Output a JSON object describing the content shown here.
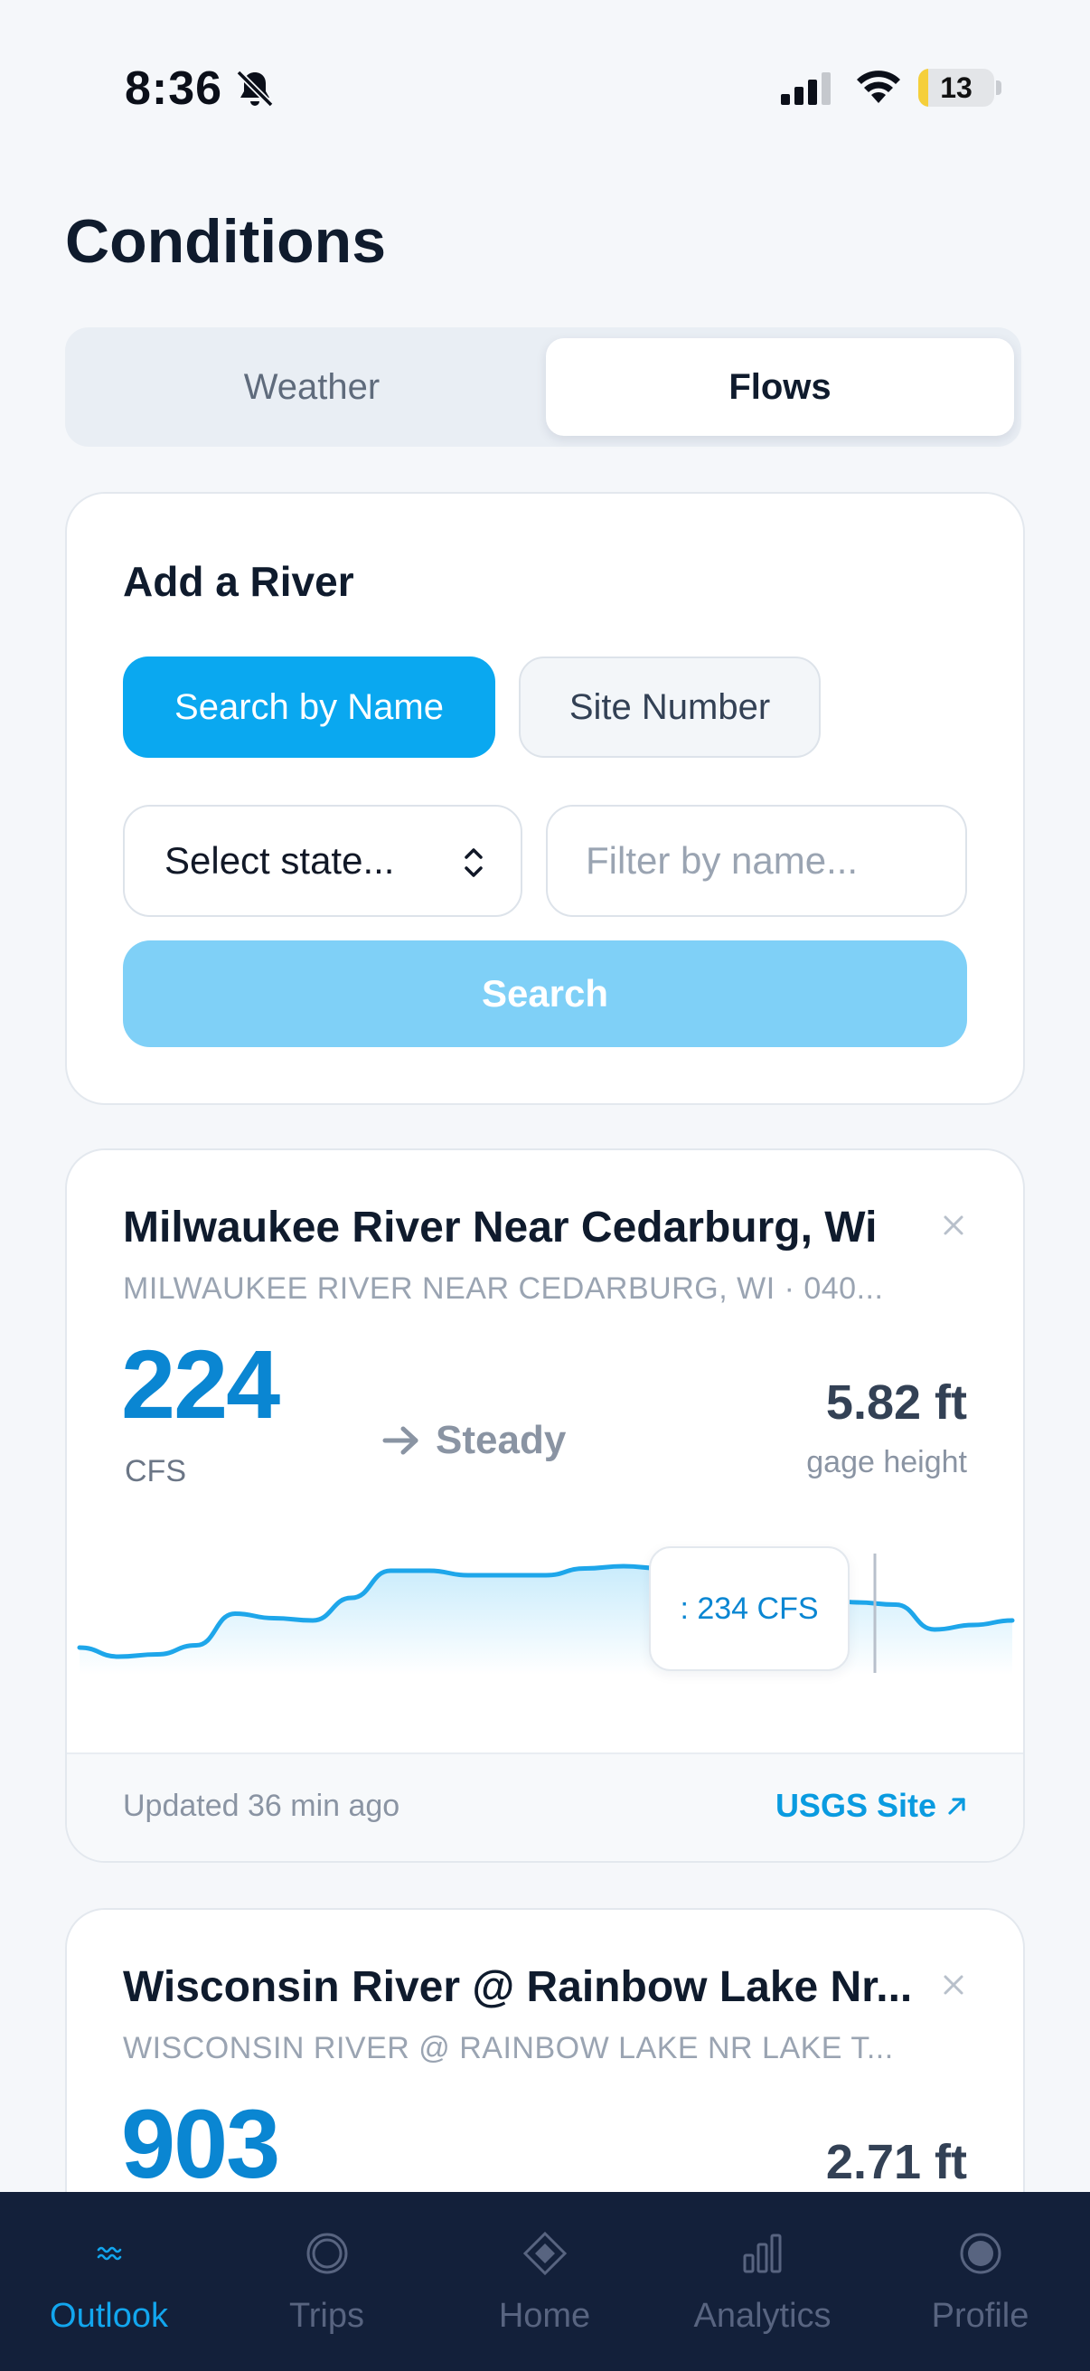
{
  "status_bar": {
    "time": "8:36",
    "battery": "13",
    "battery_level": 0.13
  },
  "page": {
    "title": "Conditions"
  },
  "tabs": {
    "weather": "Weather",
    "flows": "Flows",
    "selected": "Flows"
  },
  "add_river": {
    "title": "Add a River",
    "modes": {
      "by_name": "Search by Name",
      "site_number": "Site Number",
      "selected": "Search by Name"
    },
    "state_select": "Select state...",
    "name_filter_placeholder": "Filter by name...",
    "search_label": "Search"
  },
  "rivers": [
    {
      "name": "Milwaukee River Near Cedarburg, Wi",
      "subtitle": "MILWAUKEE RIVER NEAR CEDARBURG, WI · 040...",
      "flow": "224",
      "unit": "CFS",
      "trend": "Steady",
      "gage_height": "5.82 ft",
      "gage_label": "gage height",
      "tooltip": ": 234 CFS",
      "updated": "Updated 36 min ago",
      "link": "USGS Site",
      "series": [
        200,
        196,
        197,
        201,
        215,
        213,
        212,
        222,
        234,
        234,
        232,
        232,
        232,
        235,
        236,
        235,
        232,
        228,
        225,
        222,
        220,
        219,
        208,
        210,
        212
      ]
    },
    {
      "name": "Wisconsin River @ Rainbow Lake Nr...",
      "subtitle": "WISCONSIN RIVER @ RAINBOW LAKE NR LAKE T...",
      "flow": "903",
      "gage_height": "2.71 ft"
    }
  ],
  "nav": {
    "items": [
      {
        "label": "Outlook",
        "icon": "waves-icon",
        "active": true
      },
      {
        "label": "Trips",
        "icon": "trips-icon",
        "active": false
      },
      {
        "label": "Home",
        "icon": "home-diamond-icon",
        "active": false
      },
      {
        "label": "Analytics",
        "icon": "bar-chart-icon",
        "active": false
      },
      {
        "label": "Profile",
        "icon": "profile-icon",
        "active": false
      }
    ]
  },
  "colors": {
    "accent": "#0aa8f0",
    "flow_value": "#0a86d2",
    "tab_bar": "#13203a",
    "inactive_tab": "#586480"
  }
}
